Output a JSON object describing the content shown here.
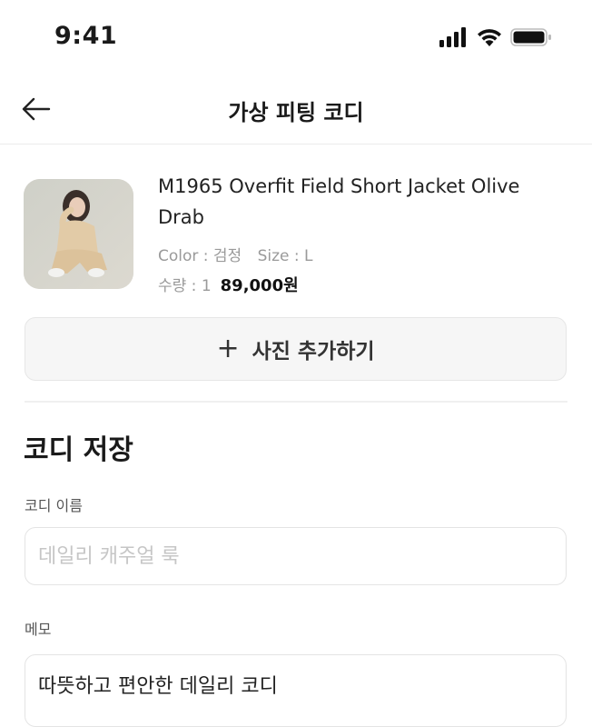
{
  "status_bar": {
    "time": "9:41"
  },
  "header": {
    "title": "가상 피팅 코디"
  },
  "product": {
    "name": "M1965 Overfit Field Short Jacket Olive Drab",
    "color": "Color : 검정",
    "size": "Size : L",
    "quantity": "수량 : 1",
    "price": "89,000원"
  },
  "add_photo": {
    "plus": "+",
    "label": "사진 추가하기"
  },
  "save_section": {
    "title": "코디 저장",
    "name_label": "코디 이름",
    "name_placeholder": "데일리 캐주얼 룩",
    "memo_label": "메모",
    "memo_value": "따뜻하고 편안한 데일리 코디"
  },
  "colors": {
    "accent_text": "#111111",
    "muted": "#9a9a9a",
    "button_bg": "#f6f6f6"
  }
}
